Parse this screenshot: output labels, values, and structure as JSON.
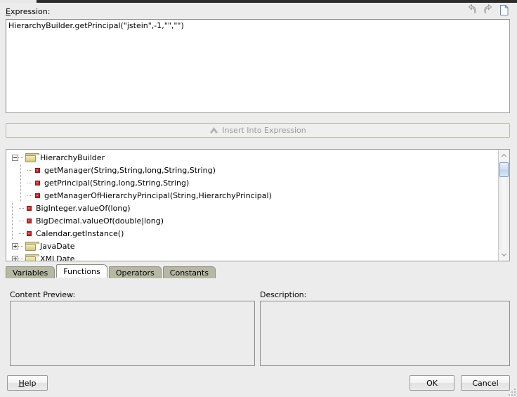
{
  "dialog": {
    "title_strip_color": "#2b2b2b",
    "background": "#ececec"
  },
  "expression": {
    "label": "Expression:",
    "label_mnemonic": "E",
    "value": "HierarchyBuilder.getPrincipal(\"jstein\",-1,\"\",\"\")",
    "toolbar": [
      {
        "name": "undo-icon",
        "title": "Undo",
        "enabled": false
      },
      {
        "name": "redo-icon",
        "title": "Redo",
        "enabled": false
      },
      {
        "name": "new-document-icon",
        "title": "Clear",
        "enabled": true
      }
    ]
  },
  "insert_button": {
    "label": "Insert Into Expression",
    "icon": "caret-up-icon",
    "enabled": false,
    "text_color": "#9a9a9a"
  },
  "tree": {
    "rows": [
      {
        "type": "folder",
        "expander": "minus",
        "depth": 0,
        "label": "HierarchyBuilder"
      },
      {
        "type": "method",
        "expander": "none",
        "depth": 1,
        "label": "getManager(String,String,long,String,String)"
      },
      {
        "type": "method",
        "expander": "none",
        "depth": 1,
        "label": "getPrincipal(String,long,String,String)"
      },
      {
        "type": "method",
        "expander": "none",
        "depth": 1,
        "label": "getManagerOfHierarchyPrincipal(String,HierarchyPrincipal)"
      },
      {
        "type": "method",
        "expander": "none",
        "depth": 0,
        "label": "BigInteger.valueOf(long)"
      },
      {
        "type": "method",
        "expander": "none",
        "depth": 0,
        "label": "BigDecimal.valueOf(double|long)"
      },
      {
        "type": "method",
        "expander": "none",
        "depth": 0,
        "label": "Calendar.getInstance()"
      },
      {
        "type": "folder",
        "expander": "plus",
        "depth": 0,
        "label": "JavaDate"
      },
      {
        "type": "folder",
        "expander": "plus",
        "depth": 0,
        "label": "XMLDate"
      }
    ],
    "scrollbar": {
      "up_arrow": "chevron-up-icon",
      "down_arrow": "chevron-down-icon",
      "thumb_color": "#bcd4ec"
    }
  },
  "tabs": [
    {
      "label": "Variables",
      "active": false
    },
    {
      "label": "Functions",
      "active": true
    },
    {
      "label": "Operators",
      "active": false
    },
    {
      "label": "Constants",
      "active": false
    }
  ],
  "content_preview": {
    "label": "Content Preview:",
    "value": ""
  },
  "description": {
    "label": "Description:",
    "value": ""
  },
  "buttons": {
    "help": "Help",
    "help_mnemonic": "H",
    "ok": "OK",
    "cancel": "Cancel"
  }
}
